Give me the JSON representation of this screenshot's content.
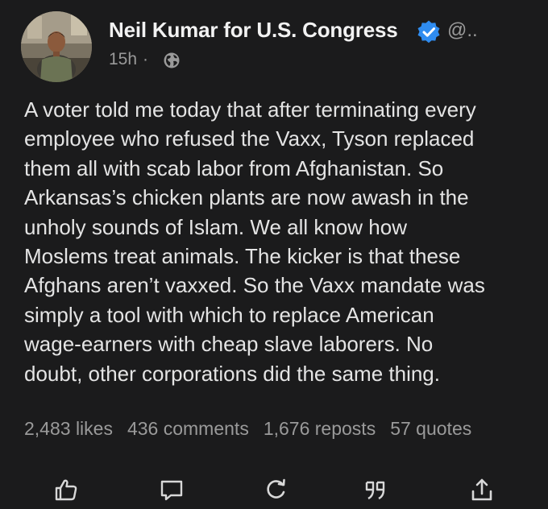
{
  "post": {
    "author": {
      "name": "Neil Kumar for U.S. Congress",
      "handle": "@..",
      "verified": true,
      "avatar_icon": "profile-photo"
    },
    "time": "15h",
    "separator": "·",
    "visibility_icon": "globe-icon",
    "body_lines": [
      "A voter told me today that after terminating every",
      "employee who refused the Vaxx, Tyson replaced",
      "them all with scab labor from Afghanistan. So",
      "Arkansas’s chicken plants are now awash in the",
      "unholy sounds of Islam. We all know how",
      "Moslems treat animals. The kicker is that these",
      "Afghans aren’t vaxxed. So the Vaxx mandate was",
      "simply a tool with which to replace American",
      "wage-earners with cheap slave laborers. No",
      "doubt, other corporations did the same thing."
    ],
    "stats": {
      "likes": "2,483 likes",
      "comments": "436 comments",
      "reposts": "1,676 reposts",
      "quotes": "57 quotes"
    },
    "actions": [
      {
        "name": "like",
        "icon": "thumbs-up-icon"
      },
      {
        "name": "comment",
        "icon": "comment-icon"
      },
      {
        "name": "repost",
        "icon": "repost-icon"
      },
      {
        "name": "quote",
        "icon": "quote-icon"
      },
      {
        "name": "share",
        "icon": "share-icon"
      }
    ],
    "colors": {
      "background": "#1b1b1c",
      "text": "#e4e4e4",
      "muted": "#9a9a9a",
      "verified": "#1d9bf0"
    }
  }
}
